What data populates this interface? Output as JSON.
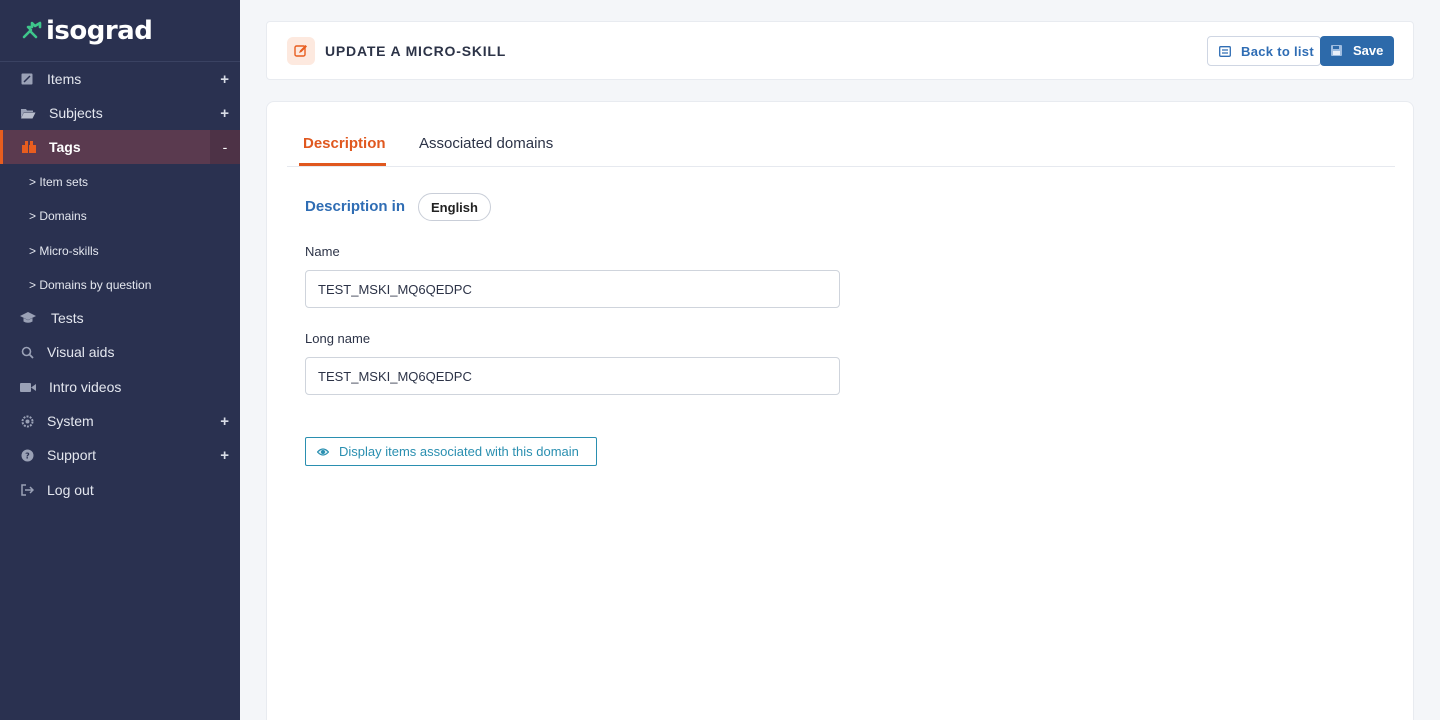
{
  "brand": {
    "name": "isograd",
    "accent": "#e85d1f"
  },
  "sidebar": {
    "items": [
      {
        "label": "Items",
        "icon": "pencil-square-icon",
        "expander": "+"
      },
      {
        "label": "Subjects",
        "icon": "folder-open-icon",
        "expander": "+"
      },
      {
        "label": "Tags",
        "icon": "tags-icon",
        "expander": "-"
      },
      {
        "label": "Tests",
        "icon": "graduation-cap-icon",
        "expander": ""
      },
      {
        "label": "Visual aids",
        "icon": "magnifier-icon",
        "expander": ""
      },
      {
        "label": "Intro videos",
        "icon": "video-camera-icon",
        "expander": ""
      },
      {
        "label": "System",
        "icon": "gear-icon",
        "expander": "+"
      },
      {
        "label": "Support",
        "icon": "question-circle-icon",
        "expander": "+"
      },
      {
        "label": "Log out",
        "icon": "sign-out-icon",
        "expander": ""
      }
    ],
    "sub_items": [
      "> Item sets",
      "> Domains",
      "> Micro-skills",
      "> Domains by question"
    ]
  },
  "header": {
    "title": "UPDATE A MICRO-SKILL",
    "back_label": "Back to list",
    "save_label": "Save"
  },
  "tabs": [
    {
      "label": "Description",
      "active": true
    },
    {
      "label": "Associated domains",
      "active": false
    }
  ],
  "description": {
    "heading": "Description in",
    "language": "English"
  },
  "form": {
    "name_label": "Name",
    "name_value": "TEST_MSKI_MQ6QEDPC",
    "long_name_label": "Long name",
    "long_name_value": "TEST_MSKI_MQ6QEDPC"
  },
  "actions": {
    "display_items_label": "Display items associated with this domain"
  }
}
